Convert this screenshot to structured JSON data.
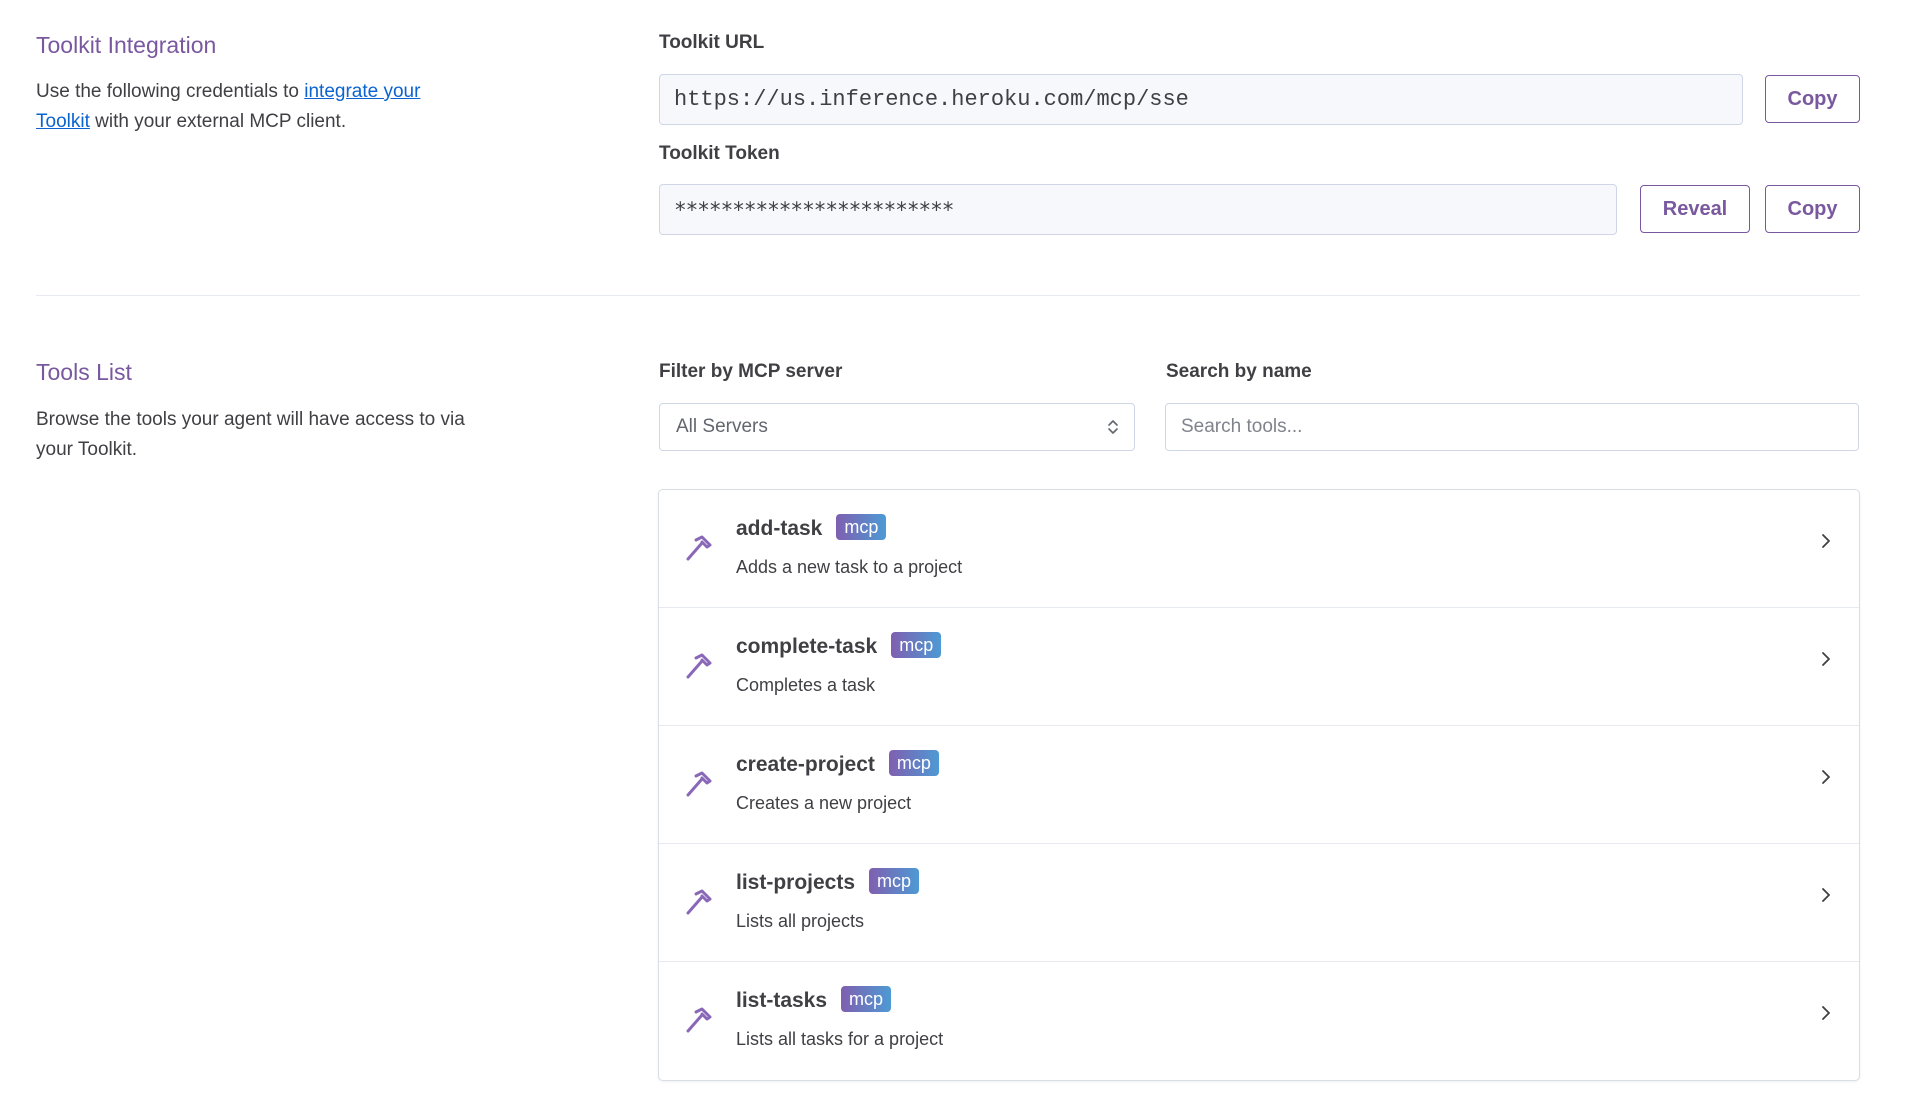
{
  "integration": {
    "title": "Toolkit Integration",
    "desc_before": "Use the following credentials to ",
    "desc_link": "integrate your Toolkit",
    "desc_after": " with your external MCP client.",
    "url_label": "Toolkit URL",
    "url_value": "https://us.inference.heroku.com/mcp/sse",
    "token_label": "Toolkit Token",
    "token_value": "************************",
    "copy_label": "Copy",
    "reveal_label": "Reveal"
  },
  "tools_section": {
    "title": "Tools List",
    "desc": "Browse the tools your agent will have access to via your Toolkit.",
    "filter_label": "Filter by MCP server",
    "filter_value": "All Servers",
    "search_label": "Search by name",
    "search_placeholder": "Search tools...",
    "tools": [
      {
        "name": "add-task",
        "badge": "mcp",
        "desc": "Adds a new task to a project"
      },
      {
        "name": "complete-task",
        "badge": "mcp",
        "desc": "Completes a task"
      },
      {
        "name": "create-project",
        "badge": "mcp",
        "desc": "Creates a new project"
      },
      {
        "name": "list-projects",
        "badge": "mcp",
        "desc": "Lists all projects"
      },
      {
        "name": "list-tasks",
        "badge": "mcp",
        "desc": "Lists all tasks for a project"
      }
    ]
  },
  "icons": {
    "tool": "hammer-icon",
    "row_chevron": "chevron-right-icon",
    "select_chevron": "chevron-up-down-icon"
  },
  "colors": {
    "accent": "#79589f",
    "link": "#0a63d1",
    "badge_start": "#7f5fb0",
    "badge_end": "#4d9ad4"
  }
}
